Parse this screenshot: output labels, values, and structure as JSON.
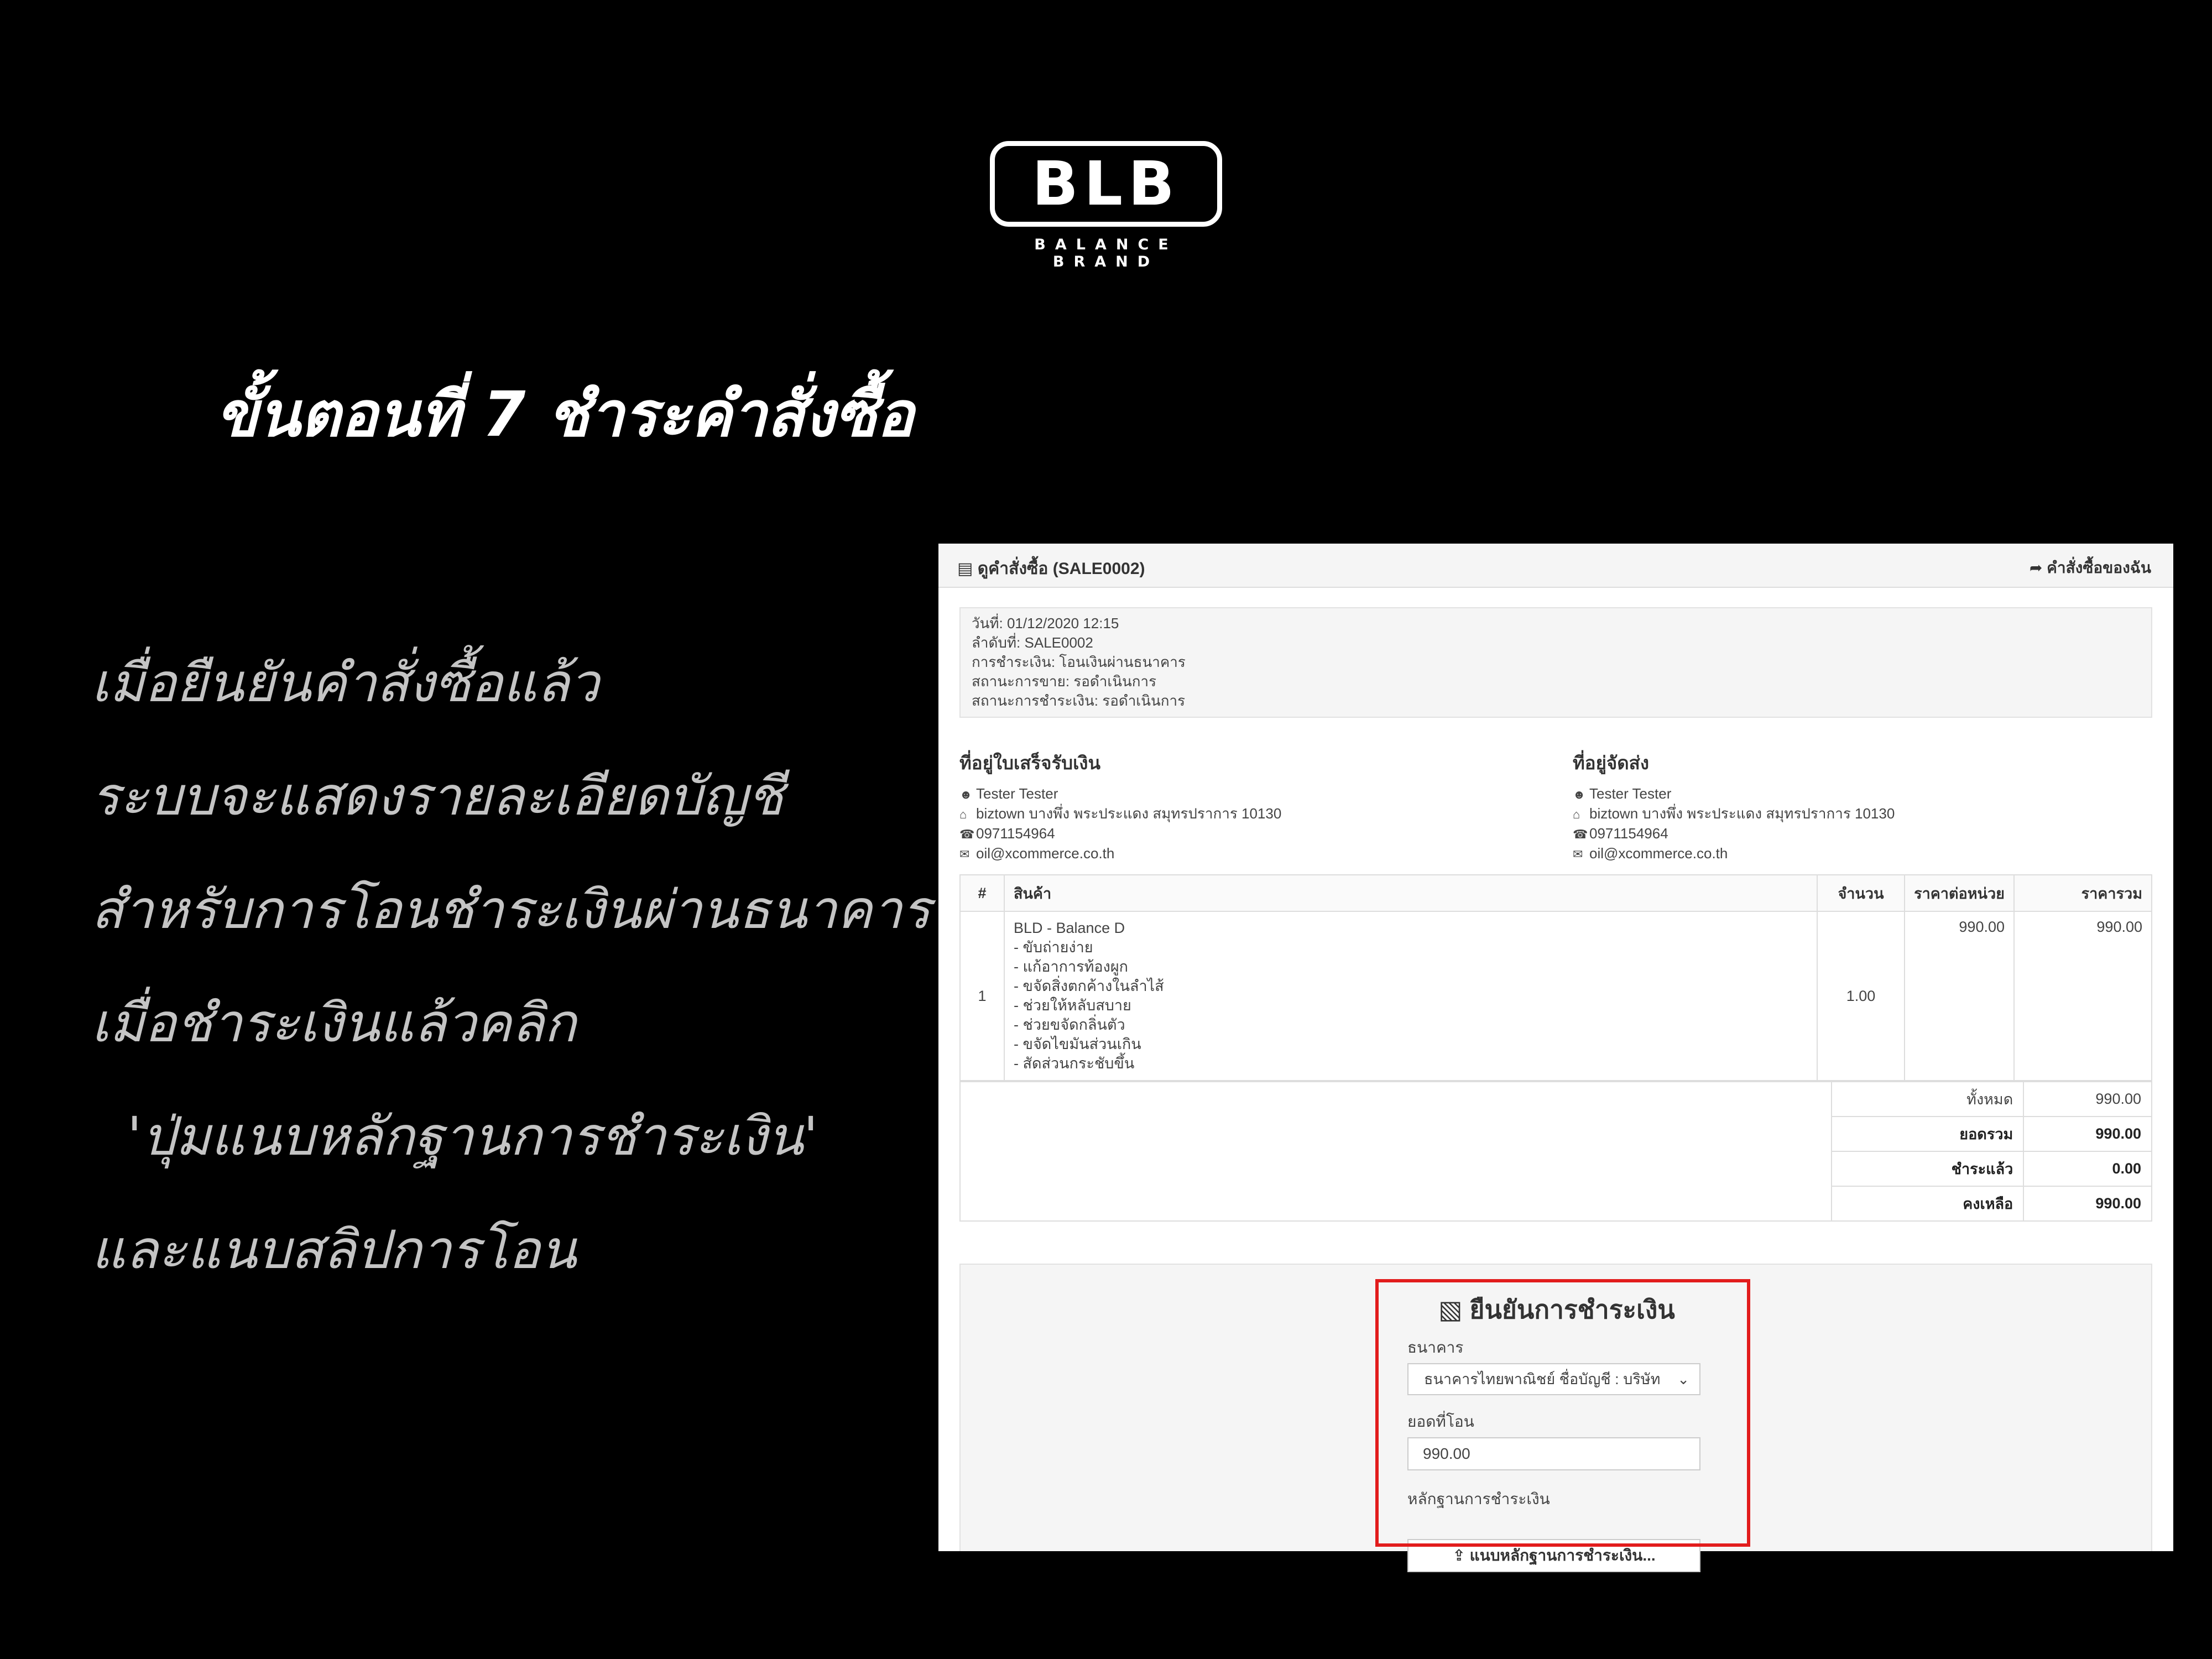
{
  "logo": {
    "mark": "BLB",
    "tagline": "BALANCE BRAND"
  },
  "headline": "ขั้นตอนที่  7  ชำระคำสั่งซื้อ",
  "instructions": [
    "เมื่อยืนยันคำสั่งซื้อแล้ว",
    "ระบบจะแสดงรายละเอียดบัญชี",
    "สำหรับการโอนชำระเงินผ่านธนาคาร",
    "เมื่อชำระเงินแล้วคลิก",
    "'ปุ่มแนบหลักฐานการชำระเงิน'",
    "และแนบสลิปการโอน"
  ],
  "order": {
    "title": "ดูคำสั่งซื้อ (SALE0002)",
    "my_orders_link": "คำสั่งซื้อของฉัน",
    "info": [
      "วันที่: 01/12/2020 12:15",
      "ลำดับที่: SALE0002",
      "การชำระเงิน: โอนเงินผ่านธนาคาร",
      "สถานะการขาย: รอดำเนินการ",
      "สถานะการชำระเงิน: รอดำเนินการ"
    ],
    "billing": {
      "heading": "ที่อยู่ใบเสร็จรับเงิน",
      "name": "Tester Tester",
      "address": "biztown บางพึ่ง พระประแดง สมุทรปราการ 10130",
      "phone": "0971154964",
      "email": "oil@xcommerce.co.th"
    },
    "shipping": {
      "heading": "ที่อยู่จัดส่ง",
      "name": "Tester Tester",
      "address": "biztown บางพึ่ง พระประแดง สมุทรปราการ 10130",
      "phone": "0971154964",
      "email": "oil@xcommerce.co.th"
    },
    "table": {
      "headers": [
        "#",
        "สินค้า",
        "จำนวน",
        "ราคาต่อหน่วย",
        "ราคารวม"
      ],
      "rows": [
        {
          "no": "1",
          "product": "BLD - Balance D",
          "details": [
            "- ขับถ่ายง่าย",
            "- แก้อาการท้องผูก",
            "- ขจัดสิ่งตกค้างในลำไส้",
            "- ช่วยให้หลับสบาย",
            "- ช่วยขจัดกลิ่นตัว",
            "- ขจัดไขมันส่วนเกิน",
            "- สัดส่วนกระชับขึ้น"
          ],
          "qty": "1.00",
          "unit_price": "990.00",
          "total": "990.00"
        }
      ]
    },
    "totals": [
      {
        "label": "ทั้งหมด",
        "value": "990.00"
      },
      {
        "label": "ยอดรวม",
        "value": "990.00"
      },
      {
        "label": "ชำระแล้ว",
        "value": "0.00"
      },
      {
        "label": "คงเหลือ",
        "value": "990.00"
      }
    ]
  },
  "payment_form": {
    "title": "ยืนยันการชำระเงิน",
    "bank_label": "ธนาคาร",
    "bank_value": "ธนาคารไทยพาณิชย์ ชื่อบัญชี : บริษัท",
    "amount_label": "ยอดที่โอน",
    "amount_value": "990.00",
    "proof_label": "หลักฐานการชำระเงิน",
    "upload_button": "แนบหลักฐานการชำระเงิน..."
  },
  "colors": {
    "highlight": "#e21c1c",
    "background": "#000000"
  },
  "icons": [
    "list-icon",
    "share-icon",
    "user-icon",
    "home-icon",
    "phone-icon",
    "envelope-icon",
    "credit-card-icon",
    "chevron-down-icon",
    "upload-icon"
  ]
}
